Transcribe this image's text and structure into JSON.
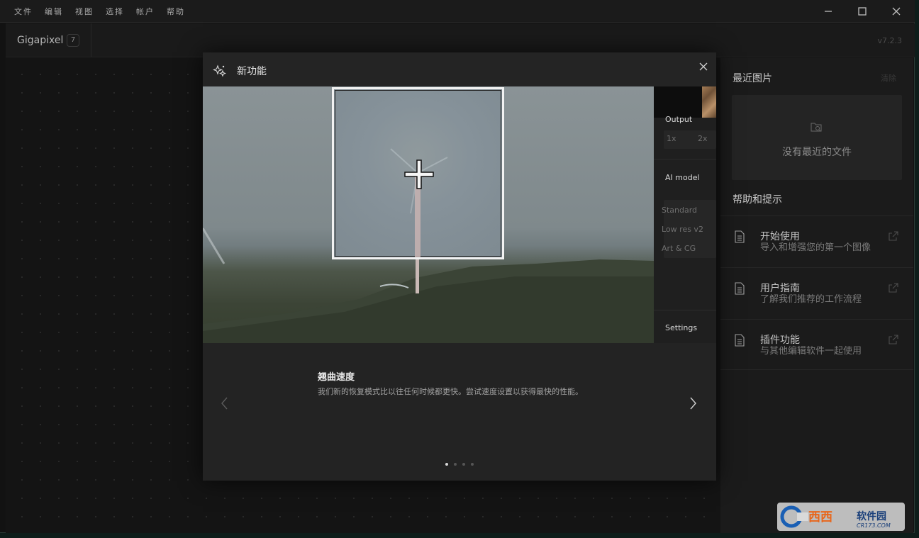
{
  "menubar": {
    "items": [
      "文件",
      "编辑",
      "视图",
      "选择",
      "帐户",
      "帮助"
    ]
  },
  "header": {
    "app_name": "Gigapixel",
    "badge": "7",
    "version": "v7.2.3"
  },
  "right_panel": {
    "recent_title": "最近图片",
    "clear_label": "清除",
    "recent_empty": "没有最近的文件",
    "help_title": "帮助和提示",
    "help_items": [
      {
        "title": "开始使用",
        "desc": "导入和增强您的第一个图像"
      },
      {
        "title": "用户指南",
        "desc": "了解我们推荐的工作流程"
      },
      {
        "title": "插件功能",
        "desc": "与其他编辑软件一起使用"
      }
    ]
  },
  "dialog": {
    "title": "新功能",
    "side_panel": {
      "output_label": "Output",
      "output_options": [
        "1x",
        "2x"
      ],
      "ai_model_label": "AI model",
      "models": [
        "Standard",
        "Low res v2",
        "Art & CG"
      ],
      "settings_label": "Settings"
    },
    "feature": {
      "title": "翘曲速度",
      "desc": "我们新的恢复模式比以往任何时候都更快。尝试速度设置以获得最快的性能。"
    },
    "pagination": {
      "total": 4,
      "active": 1
    }
  },
  "watermark": {
    "brand": "西西软件园",
    "site": "CR173.COM"
  },
  "colors": {
    "window_bg": "#121212",
    "panel_bg": "#1b1b1b",
    "dialog_bg": "#232323",
    "accent_text": "#e6e6e6"
  }
}
